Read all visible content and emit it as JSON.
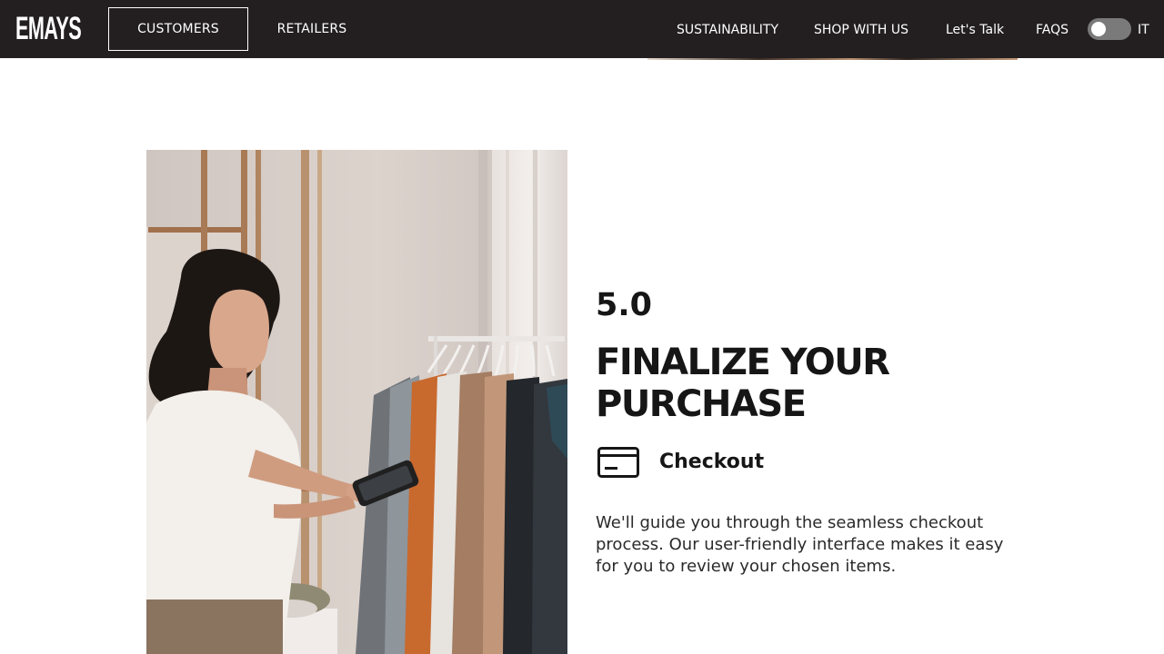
{
  "header": {
    "logo_text": "EMAYS",
    "tabs": [
      {
        "label": "CUSTOMERS",
        "active": true
      },
      {
        "label": "RETAILERS",
        "active": false
      }
    ],
    "links": [
      "SUSTAINABILITY",
      "SHOP WITH US",
      "Let's Talk",
      "FAQS"
    ],
    "language_toggle": {
      "state": "off",
      "label": "IT"
    }
  },
  "step": {
    "number": "5.0",
    "title": "FINALIZE YOUR PURCHASE",
    "feature": {
      "icon": "credit-card-icon",
      "label": "Checkout"
    },
    "description": "We'll guide you through the seamless checkout process. Our user-friendly interface makes it easy for you to review your chosen items."
  },
  "colors": {
    "nav_background": "#231f20",
    "nav_text": "#ffffff",
    "heading": "#161616",
    "body_text": "#2a2a2a",
    "toggle_track": "#7a7a7a"
  }
}
